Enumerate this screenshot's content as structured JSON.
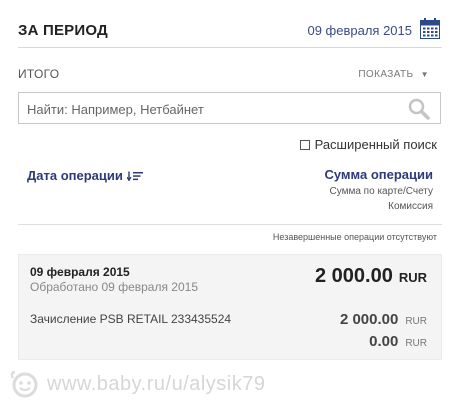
{
  "header": {
    "title": "ЗА ПЕРИОД",
    "date": "09 февраля 2015",
    "calendar_icon": "calendar-icon"
  },
  "summary": {
    "itogo": "ИТОГО",
    "show_label": "ПОКАЗАТЬ",
    "show_icon": "caret-down-icon"
  },
  "search": {
    "placeholder": "Найти: Например, Нетбайнет",
    "value": "",
    "icon": "search-icon"
  },
  "advanced_search": {
    "label": "Расширенный поиск",
    "checked": false
  },
  "columns": {
    "date_header": "Дата операции",
    "sort_icon": "sort-desc-icon",
    "sum_header": "Сумма операции",
    "sum_sub1": "Сумма по карте/Счету",
    "sum_sub2": "Комиссия"
  },
  "no_incomplete": "Незавершенные операции отсутствуют",
  "operation": {
    "date": "09 февраля 2015",
    "processed": "Обработано 09 февраля 2015",
    "total": "2 000.00",
    "total_currency": "RUR",
    "description": "Зачисление PSB RETAIL 233435524",
    "card_amount": "2 000.00",
    "card_currency": "RUR",
    "commission": "0.00",
    "commission_currency": "RUR"
  },
  "watermark": {
    "text": "www.baby.ru/u/alysik79",
    "icon": "baby-ru-logo-icon"
  },
  "colors": {
    "accent": "#2c3a78",
    "date_text": "#3b4a86",
    "card_bg": "#f4f4f4"
  }
}
